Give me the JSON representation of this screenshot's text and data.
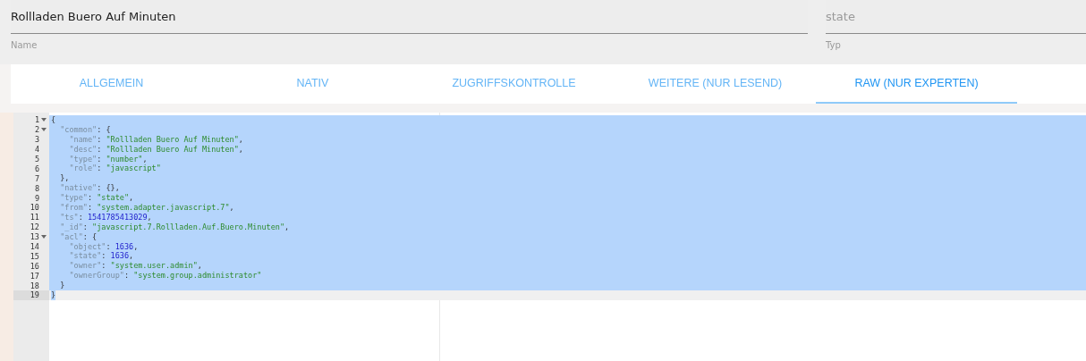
{
  "fields": [
    {
      "value": "Rollladen Buero Auf Minuten",
      "label": "Name",
      "kind": "value"
    },
    {
      "placeholder": "state",
      "label": "Typ",
      "kind": "placeholder"
    }
  ],
  "tabs": [
    {
      "label": "ALLGEMEIN",
      "selected": false
    },
    {
      "label": "NATIV",
      "selected": false
    },
    {
      "label": "ZUGRIFFSKONTROLLE",
      "selected": false
    },
    {
      "label": "WEITERE (NUR LESEND)",
      "selected": false
    },
    {
      "label": "RAW (NUR EXPERTEN)",
      "selected": true
    }
  ],
  "editor": {
    "lines": [
      {
        "number": "1",
        "fold": true,
        "active": false,
        "selected": true,
        "tokens": [
          {
            "kind": "punct",
            "text": "{"
          }
        ]
      },
      {
        "number": "2",
        "fold": true,
        "active": false,
        "selected": true,
        "tokens": [
          {
            "kind": "key",
            "text": "  \"common\""
          },
          {
            "kind": "punct",
            "text": ": {"
          }
        ]
      },
      {
        "number": "3",
        "fold": false,
        "active": false,
        "selected": true,
        "tokens": [
          {
            "kind": "key",
            "text": "    \"name\""
          },
          {
            "kind": "punct",
            "text": ": "
          },
          {
            "kind": "string",
            "text": "\"Rollladen Buero Auf Minuten\""
          },
          {
            "kind": "punct",
            "text": ","
          }
        ]
      },
      {
        "number": "4",
        "fold": false,
        "active": false,
        "selected": true,
        "tokens": [
          {
            "kind": "key",
            "text": "    \"desc\""
          },
          {
            "kind": "punct",
            "text": ": "
          },
          {
            "kind": "string",
            "text": "\"Rollladen Buero Auf Minuten\""
          },
          {
            "kind": "punct",
            "text": ","
          }
        ]
      },
      {
        "number": "5",
        "fold": false,
        "active": false,
        "selected": true,
        "tokens": [
          {
            "kind": "key",
            "text": "    \"type\""
          },
          {
            "kind": "punct",
            "text": ": "
          },
          {
            "kind": "string",
            "text": "\"number\""
          },
          {
            "kind": "punct",
            "text": ","
          }
        ]
      },
      {
        "number": "6",
        "fold": false,
        "active": false,
        "selected": true,
        "tokens": [
          {
            "kind": "key",
            "text": "    \"role\""
          },
          {
            "kind": "punct",
            "text": ": "
          },
          {
            "kind": "string",
            "text": "\"javascript\""
          }
        ]
      },
      {
        "number": "7",
        "fold": false,
        "active": false,
        "selected": true,
        "tokens": [
          {
            "kind": "punct",
            "text": "  },"
          }
        ]
      },
      {
        "number": "8",
        "fold": false,
        "active": false,
        "selected": true,
        "tokens": [
          {
            "kind": "key",
            "text": "  \"native\""
          },
          {
            "kind": "punct",
            "text": ": {},"
          }
        ]
      },
      {
        "number": "9",
        "fold": false,
        "active": false,
        "selected": true,
        "tokens": [
          {
            "kind": "key",
            "text": "  \"type\""
          },
          {
            "kind": "punct",
            "text": ": "
          },
          {
            "kind": "string",
            "text": "\"state\""
          },
          {
            "kind": "punct",
            "text": ","
          }
        ]
      },
      {
        "number": "10",
        "fold": false,
        "active": false,
        "selected": true,
        "tokens": [
          {
            "kind": "key",
            "text": "  \"from\""
          },
          {
            "kind": "punct",
            "text": ": "
          },
          {
            "kind": "string",
            "text": "\"system.adapter.javascript.7\""
          },
          {
            "kind": "punct",
            "text": ","
          }
        ]
      },
      {
        "number": "11",
        "fold": false,
        "active": false,
        "selected": true,
        "tokens": [
          {
            "kind": "key",
            "text": "  \"ts\""
          },
          {
            "kind": "punct",
            "text": ": "
          },
          {
            "kind": "number",
            "text": "1541785413029"
          },
          {
            "kind": "punct",
            "text": ","
          }
        ]
      },
      {
        "number": "12",
        "fold": false,
        "active": false,
        "selected": true,
        "tokens": [
          {
            "kind": "key",
            "text": "  \"_id\""
          },
          {
            "kind": "punct",
            "text": ": "
          },
          {
            "kind": "string",
            "text": "\"javascript.7.Rollladen.Auf.Buero.Minuten\""
          },
          {
            "kind": "punct",
            "text": ","
          }
        ]
      },
      {
        "number": "13",
        "fold": true,
        "active": false,
        "selected": true,
        "tokens": [
          {
            "kind": "key",
            "text": "  \"acl\""
          },
          {
            "kind": "punct",
            "text": ": {"
          }
        ]
      },
      {
        "number": "14",
        "fold": false,
        "active": false,
        "selected": true,
        "tokens": [
          {
            "kind": "key",
            "text": "    \"object\""
          },
          {
            "kind": "punct",
            "text": ": "
          },
          {
            "kind": "number",
            "text": "1636"
          },
          {
            "kind": "punct",
            "text": ","
          }
        ]
      },
      {
        "number": "15",
        "fold": false,
        "active": false,
        "selected": true,
        "tokens": [
          {
            "kind": "key",
            "text": "    \"state\""
          },
          {
            "kind": "punct",
            "text": ": "
          },
          {
            "kind": "number",
            "text": "1636"
          },
          {
            "kind": "punct",
            "text": ","
          }
        ]
      },
      {
        "number": "16",
        "fold": false,
        "active": false,
        "selected": true,
        "tokens": [
          {
            "kind": "key",
            "text": "    \"owner\""
          },
          {
            "kind": "punct",
            "text": ": "
          },
          {
            "kind": "string",
            "text": "\"system.user.admin\""
          },
          {
            "kind": "punct",
            "text": ","
          }
        ]
      },
      {
        "number": "17",
        "fold": false,
        "active": false,
        "selected": true,
        "tokens": [
          {
            "kind": "key",
            "text": "    \"ownerGroup\""
          },
          {
            "kind": "punct",
            "text": ": "
          },
          {
            "kind": "string",
            "text": "\"system.group.administrator\""
          }
        ]
      },
      {
        "number": "18",
        "fold": false,
        "active": false,
        "selected": true,
        "tokens": [
          {
            "kind": "punct",
            "text": "  }"
          }
        ]
      },
      {
        "number": "19",
        "fold": false,
        "active": true,
        "selected": false,
        "tokens": [
          {
            "kind": "punct",
            "text": "}"
          }
        ]
      }
    ]
  }
}
